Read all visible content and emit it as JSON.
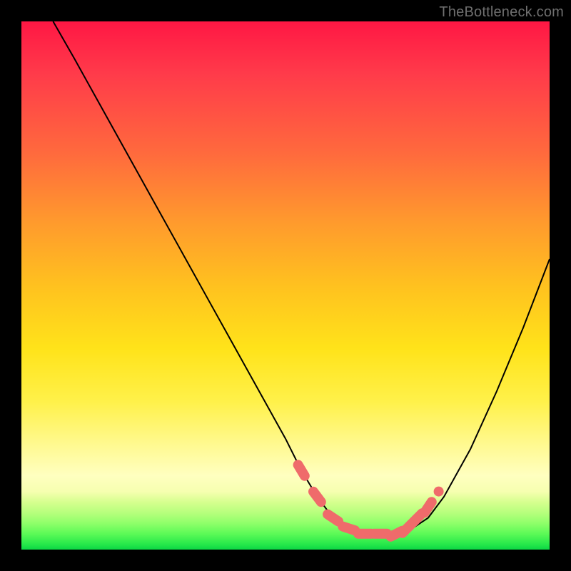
{
  "watermark": "TheBottleneck.com",
  "chart_data": {
    "type": "line",
    "title": "",
    "xlabel": "",
    "ylabel": "",
    "xlim": [
      0,
      100
    ],
    "ylim": [
      0,
      100
    ],
    "grid": false,
    "legend": false,
    "series": [
      {
        "name": "curve",
        "x": [
          6,
          10,
          15,
          20,
          25,
          30,
          35,
          40,
          45,
          50,
          53,
          56,
          59,
          62,
          65,
          68,
          71,
          74,
          77,
          80,
          85,
          90,
          95,
          100
        ],
        "values": [
          100,
          93,
          84,
          75,
          66,
          57,
          48,
          39,
          30,
          21,
          15,
          10,
          6,
          4,
          3,
          3,
          3,
          4,
          6,
          10,
          19,
          30,
          42,
          55
        ]
      }
    ],
    "highlight_markers": {
      "name": "valley-markers",
      "color": "#ef6b6b",
      "points": [
        {
          "x": 53,
          "y": 15
        },
        {
          "x": 56,
          "y": 10
        },
        {
          "x": 59,
          "y": 6
        },
        {
          "x": 62,
          "y": 4
        },
        {
          "x": 65,
          "y": 3
        },
        {
          "x": 68,
          "y": 3
        },
        {
          "x": 71,
          "y": 3
        },
        {
          "x": 73,
          "y": 4
        },
        {
          "x": 75,
          "y": 6
        },
        {
          "x": 77,
          "y": 8
        },
        {
          "x": 79,
          "y": 11
        }
      ]
    }
  }
}
